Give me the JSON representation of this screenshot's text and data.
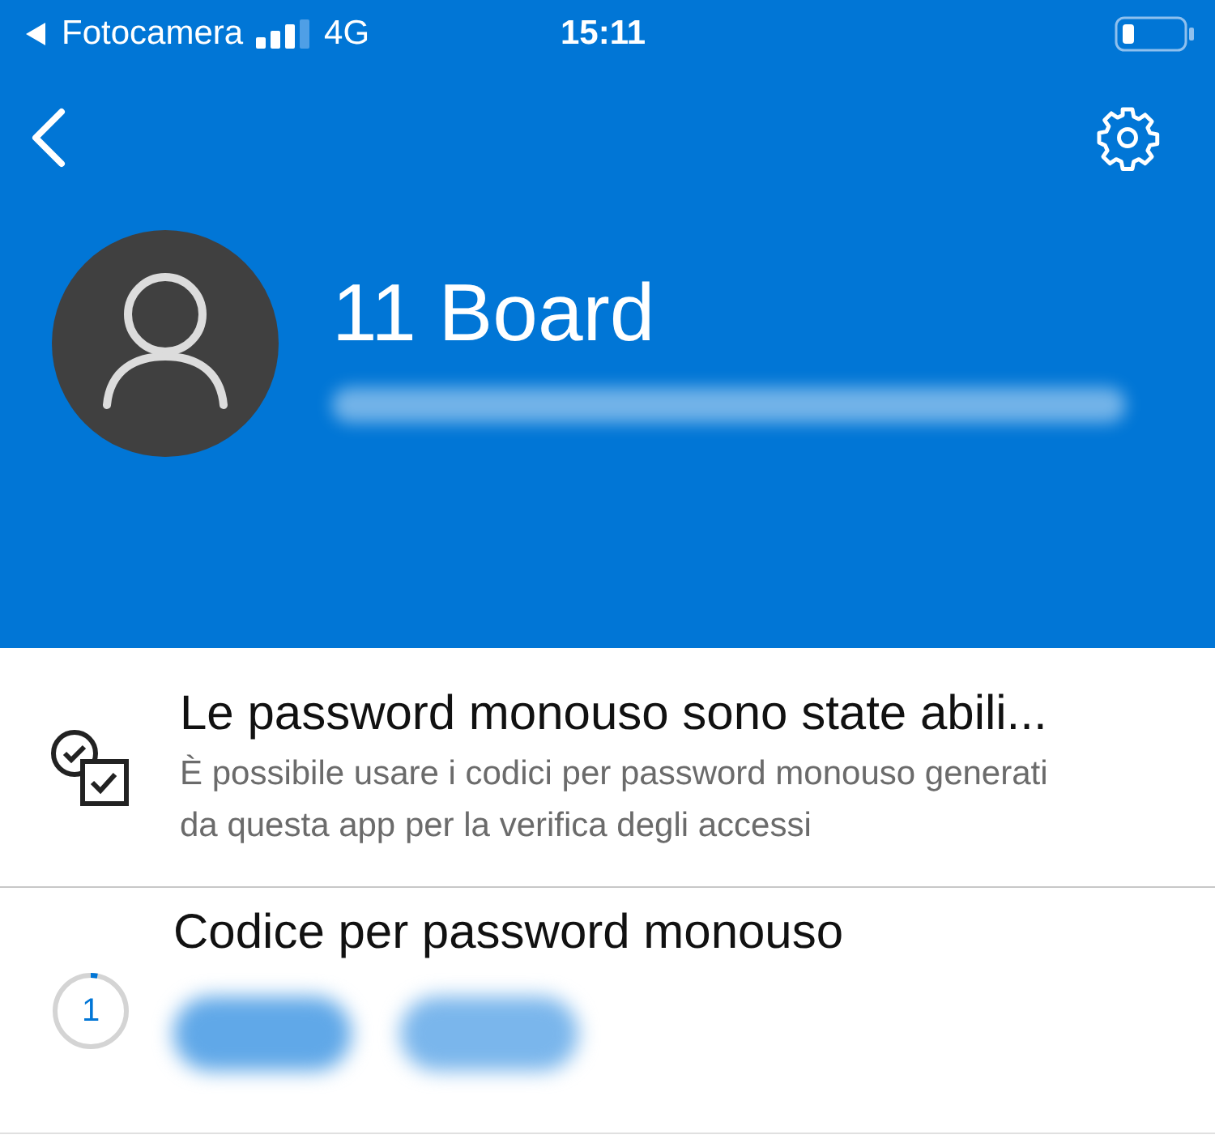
{
  "status_bar": {
    "back_app": "Fotocamera",
    "network": "4G",
    "time": "15:11"
  },
  "account": {
    "name": "11 Board"
  },
  "items": [
    {
      "kind": "notice",
      "title": "Le password monouso sono state abili...",
      "subtitle": "È possibile usare i codici per password monouso generati da questa app per la verifica degli accessi"
    },
    {
      "kind": "code",
      "title": "Codice per password monouso",
      "countdown": "1",
      "level": 0.03
    }
  ]
}
